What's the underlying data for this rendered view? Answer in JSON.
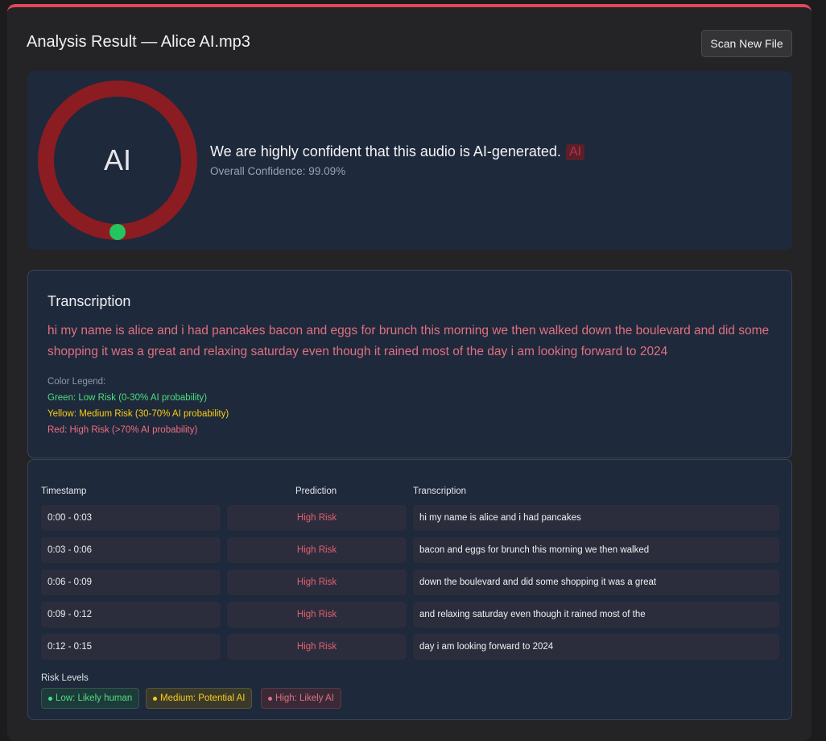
{
  "header": {
    "title": "Analysis Result — Alice AI.mp3",
    "scan_button": "Scan New File"
  },
  "result": {
    "ring_label": "AI",
    "verdict": "We are highly confident that this audio is AI-generated.",
    "badge": "AI",
    "confidence": "Overall Confidence: 99.09%",
    "ring_color": "#8b1c22",
    "marker_color": "#22c55e"
  },
  "transcription": {
    "title": "Transcription",
    "text": "hi my name is alice and i had pancakes bacon and eggs for brunch this morning we then walked down the boulevard and did some shopping it was a great and relaxing saturday even though it rained most of the day i am looking forward to 2024",
    "legend_title": "Color Legend:",
    "legend_green": "Green: Low Risk (0-30% AI probability)",
    "legend_yellow": "Yellow: Medium Risk (30-70% AI probability)",
    "legend_red": "Red: High Risk (>70% AI probability)"
  },
  "table": {
    "headers": [
      "Timestamp",
      "Prediction",
      "Transcription"
    ],
    "rows": [
      {
        "timestamp": "0:00 - 0:03",
        "prediction": "High Risk",
        "text": "hi my name is alice and i had pancakes"
      },
      {
        "timestamp": "0:03 - 0:06",
        "prediction": "High Risk",
        "text": "bacon and eggs for brunch this morning we then walked"
      },
      {
        "timestamp": "0:06 - 0:09",
        "prediction": "High Risk",
        "text": "down the boulevard and did some shopping it was a great"
      },
      {
        "timestamp": "0:09 - 0:12",
        "prediction": "High Risk",
        "text": "and relaxing saturday even though it rained most of the"
      },
      {
        "timestamp": "0:12 - 0:15",
        "prediction": "High Risk",
        "text": "day i am looking forward to 2024"
      }
    ]
  },
  "risk_levels": {
    "title": "Risk Levels",
    "low": "Low: Likely human",
    "medium": "Medium: Potential AI",
    "high": "High: Likely AI"
  },
  "colors": {
    "accent_top": "#e0485a",
    "low": "#4ade80",
    "medium": "#facc15",
    "high": "#e07080"
  }
}
